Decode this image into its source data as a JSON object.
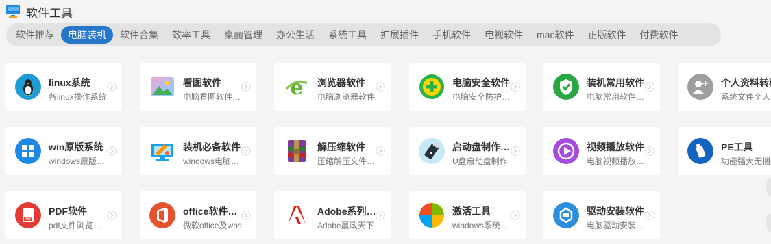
{
  "header": {
    "title": "软件工具",
    "icon": "monitor-icon"
  },
  "tabs": [
    {
      "label": "软件推荐"
    },
    {
      "label": "电脑装机",
      "active": true
    },
    {
      "label": "软件合集"
    },
    {
      "label": "效率工具"
    },
    {
      "label": "桌面管理"
    },
    {
      "label": "办公生活"
    },
    {
      "label": "系统工具"
    },
    {
      "label": "扩展插件"
    },
    {
      "label": "手机软件"
    },
    {
      "label": "电视软件"
    },
    {
      "label": "mac软件"
    },
    {
      "label": "正版软件"
    },
    {
      "label": "付费软件"
    }
  ],
  "cards": [
    {
      "name": "linux系统",
      "desc": "各linux操作系统",
      "icon": "penguin-icon",
      "color": "#1f9bd6"
    },
    {
      "name": "看图软件",
      "desc": "电脑看图软件推荐",
      "icon": "picture-icon",
      "color": "#4dbbe8"
    },
    {
      "name": "浏览器软件",
      "desc": "电脑浏览器软件",
      "icon": "ie-browser-icon",
      "color": "#5fb333"
    },
    {
      "name": "电脑安全软件",
      "desc": "电脑安全防护软件",
      "icon": "security-plus-icon",
      "color": "#2bb24c"
    },
    {
      "name": "装机常用软件",
      "desc": "电脑常用软件推荐",
      "icon": "shield-check-icon",
      "color": "#27a843"
    },
    {
      "name": "个人资料转移",
      "desc": "系统文件个人资料",
      "icon": "user-plus-icon",
      "color": "#9e9e9e"
    },
    {
      "name": "win原版系统",
      "desc": "windows原版系统",
      "icon": "windows-icon",
      "color": "#1e88e5"
    },
    {
      "name": "装机必备软件",
      "desc": "windows电脑必备",
      "icon": "monitor-tools-icon",
      "color": "#1aa1e6"
    },
    {
      "name": "解压缩软件",
      "desc": "压缩解压文件软件",
      "icon": "winrar-icon",
      "color": "#7b3f99"
    },
    {
      "name": "启动盘制作工具",
      "desc": "U盘启动盘制作",
      "icon": "usb-drive-icon",
      "color": "#1e87c6"
    },
    {
      "name": "视频播放软件",
      "desc": "电脑视频播放软件",
      "icon": "play-icon",
      "color": "#a64be0"
    },
    {
      "name": "PE工具",
      "desc": "功能强大无捆绑",
      "icon": "usb-pe-icon",
      "color": "#1565c0"
    },
    {
      "name": "PDF软件",
      "desc": "pdf文件浏览编辑",
      "icon": "pdf-icon",
      "color": "#e53935"
    },
    {
      "name": "office软件合集",
      "desc": "微软office及wps",
      "icon": "office-icon",
      "color": "#e5532d"
    },
    {
      "name": "Adobe系列软件",
      "desc": "Adobe赢政天下",
      "icon": "adobe-icon",
      "color": "#e1251b"
    },
    {
      "name": "激活工具",
      "desc": "windows系统激活",
      "icon": "windows-color-icon",
      "color": "#f25022"
    },
    {
      "name": "驱动安装软件",
      "desc": "电脑驱动安装软件",
      "icon": "driver-icon",
      "color": "#2b8fe0"
    }
  ]
}
